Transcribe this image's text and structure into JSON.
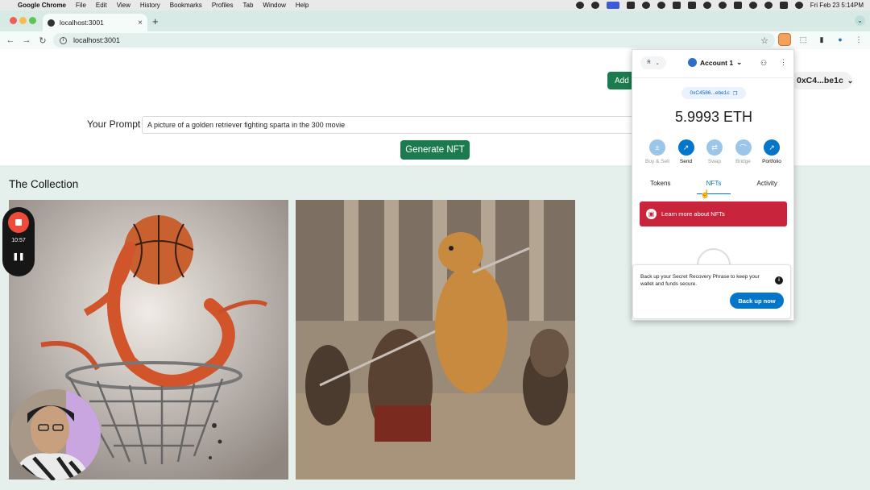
{
  "menubar": {
    "apple": "",
    "items": [
      "Google Chrome",
      "File",
      "Edit",
      "View",
      "History",
      "Bookmarks",
      "Profiles",
      "Tab",
      "Window",
      "Help"
    ],
    "datetime": "Fri Feb 23  5:14PM"
  },
  "browser": {
    "tab_title": "localhost:3001",
    "tab_close": "×",
    "new_tab": "+",
    "url": "localhost:3001",
    "back": "←",
    "forward": "→",
    "reload": "↻"
  },
  "page": {
    "add_nft_label": "Add NFT",
    "wallet_address": "0xC4...be1c",
    "prompt_label": "Your Prompt",
    "prompt_value": "A picture of a golden retriever fighting sparta in the 300 movie",
    "generate_label": "Generate NFT",
    "collection_title": "The Collection"
  },
  "recorder": {
    "time": "10:57",
    "pause": "❚❚"
  },
  "metamask": {
    "network": "R",
    "account_name": "Account 1",
    "address": "0xC4586...ebe1c",
    "balance": "5.9993 ETH",
    "actions": [
      {
        "label": "Buy & Sell",
        "icon": "buy-sell-icon",
        "glyph": "±",
        "enabled": false
      },
      {
        "label": "Send",
        "icon": "send-icon",
        "glyph": "↗",
        "enabled": true
      },
      {
        "label": "Swap",
        "icon": "swap-icon",
        "glyph": "⇄",
        "enabled": false
      },
      {
        "label": "Bridge",
        "icon": "bridge-icon",
        "glyph": "⌒",
        "enabled": false
      },
      {
        "label": "Portfolio",
        "icon": "portfolio-icon",
        "glyph": "↗",
        "enabled": true
      }
    ],
    "tabs": [
      "Tokens",
      "NFTs",
      "Activity"
    ],
    "active_tab": "NFTs",
    "banner": "Learn more about NFTs",
    "toast_text": "Back up your Secret Recovery Phrase to keep your wallet and funds secure.",
    "backup_button": "Back up now"
  },
  "colors": {
    "primary_green": "#1c7a4f",
    "metamask_blue": "#0376c9",
    "banner_red": "#c8243c",
    "collection_bg": "#e5efeb",
    "chrome_tab_strip": "#d7eae6"
  }
}
